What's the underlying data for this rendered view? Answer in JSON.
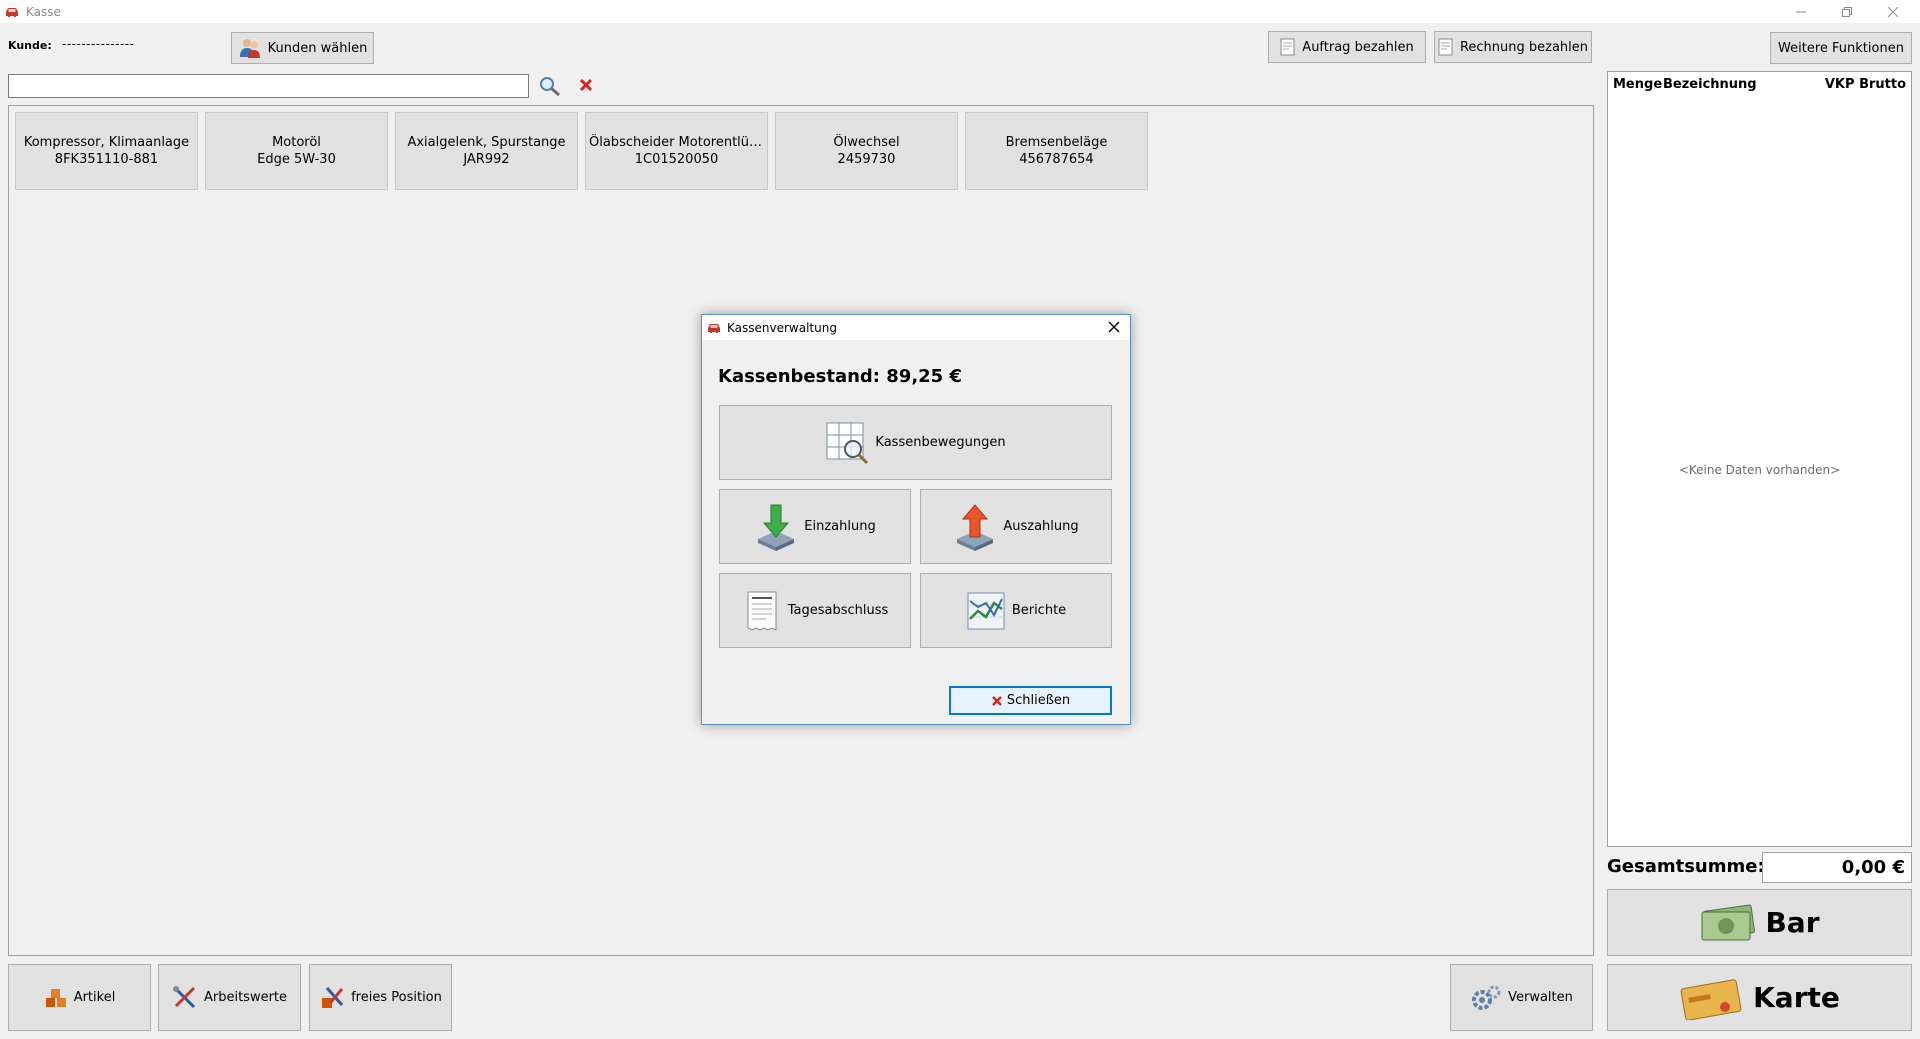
{
  "window": {
    "title": "Kasse"
  },
  "toolbar": {
    "kunde_label": "Kunde:",
    "kunde_value": "---------------",
    "kunden_waehlen": "Kunden wählen",
    "auftrag_bezahlen": "Auftrag bezahlen",
    "rechnung_bezahlen": "Rechnung bezahlen",
    "weitere_funktionen": "Weitere Funktionen",
    "search_value": ""
  },
  "tiles": [
    {
      "line1": "Kompressor, Klimaanlage",
      "line2": "8FK351110-881"
    },
    {
      "line1": "Motoröl",
      "line2": "Edge 5W-30"
    },
    {
      "line1": "Axialgelenk, Spurstange",
      "line2": "JAR992"
    },
    {
      "line1": "Ölabscheider Motorentlüftu...",
      "line2": "1C01520050"
    },
    {
      "line1": "Ölwechsel",
      "line2": "2459730"
    },
    {
      "line1": "Bremsenbeläge",
      "line2": "456787654"
    }
  ],
  "list": {
    "headers": [
      "Menge",
      "Bezeichnung",
      "VKP Brutto"
    ],
    "empty_text": "<Keine Daten vorhanden>"
  },
  "totals": {
    "label": "Gesamtsumme:",
    "value": "0,00 €"
  },
  "payment": {
    "bar": "Bar",
    "karte": "Karte"
  },
  "bottom": {
    "artikel": "Artikel",
    "arbeitswerte": "Arbeitswerte",
    "freies_position": "freies Position",
    "verwalten": "Verwalten"
  },
  "dialog": {
    "title": "Kassenverwaltung",
    "bestand": "Kassenbestand: 89,25 €",
    "kassenbewegungen": "Kassenbewegungen",
    "einzahlung": "Einzahlung",
    "auszahlung": "Auszahlung",
    "tagesabschluss": "Tagesabschluss",
    "berichte": "Berichte",
    "schliessen": "Schließen"
  },
  "colors": {
    "accent": "#0078d7",
    "dialog_border": "#5a8fc7",
    "clear_red": "#d9231e"
  }
}
